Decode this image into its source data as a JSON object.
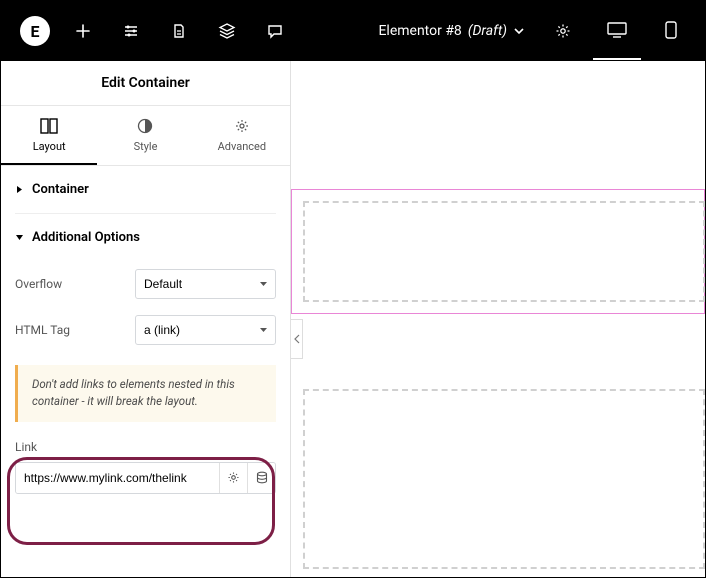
{
  "topbar": {
    "logo_letter": "E",
    "doc_title": "Elementor #8",
    "doc_status": "(Draft)"
  },
  "sidebar": {
    "title": "Edit Container",
    "tabs": {
      "layout": "Layout",
      "style": "Style",
      "advanced": "Advanced"
    },
    "sections": {
      "container": "Container",
      "additional": "Additional Options"
    },
    "overflow": {
      "label": "Overflow",
      "value": "Default"
    },
    "htmltag": {
      "label": "HTML Tag",
      "value": "a (link)"
    },
    "warning": "Don't add links to elements nested in this container - it will break the layout.",
    "link": {
      "label": "Link",
      "value": "https://www.mylink.com/thelink"
    }
  }
}
